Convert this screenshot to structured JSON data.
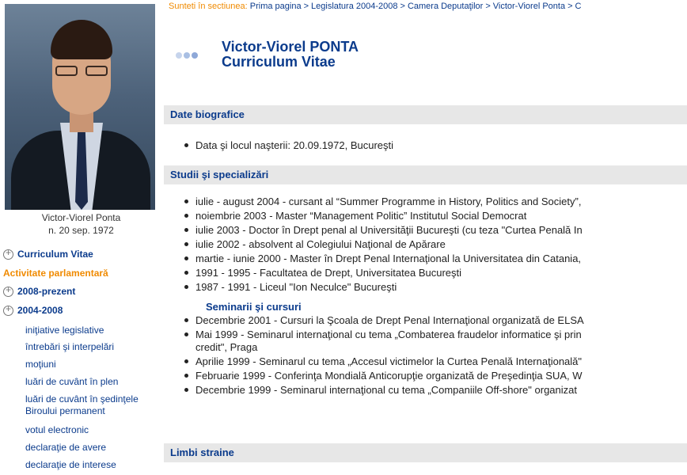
{
  "sidebar": {
    "caption_name": "Victor-Viorel Ponta",
    "caption_birth": "n. 20 sep. 1972",
    "nav_cv": "Curriculum Vitae",
    "nav_activitate": "Activitate parlamentară",
    "nav_2008": "2008-prezent",
    "nav_2004": "2004-2008",
    "sub_items": [
      "iniţiative legislative",
      "întrebări şi interpelări",
      "moţiuni",
      "luări de cuvânt în plen",
      "luări de cuvânt în şedinţele",
      "Biroului permanent",
      "votul electronic",
      "declaraţie de avere",
      "declaraţie de interese"
    ]
  },
  "breadcrumb": {
    "prefix": "Sunteti în sectiunea:",
    "items": [
      "Prima pagina",
      "Legislatura 2004-2008",
      "Camera Deputaţilor",
      "Victor-Viorel Ponta",
      "C"
    ]
  },
  "header": {
    "name": "Victor-Viorel PONTA",
    "subtitle": "Curriculum Vitae",
    "dot_colors": [
      "#c6d4ec",
      "#a9bfe3",
      "#8ea8d8"
    ]
  },
  "sections": {
    "bio_title": "Date biografice",
    "bio_items": [
      "Data şi locul naşterii: 20.09.1972, Bucureşti"
    ],
    "studies_title": "Studii şi specializări",
    "studies_items": [
      "iulie - august 2004 - cursant al “Summer Programme in History, Politics and Society”,",
      "noiembrie 2003 - Master “Management Politic” Institutul Social Democrat",
      "iulie 2003 - Doctor în Drept penal al Universităţii Bucureşti (cu teza \"Curtea Penală In",
      "iulie 2002 - absolvent al Colegiului Naţional de Apărare",
      "martie - iunie 2000 - Master în Drept Penal Internaţional la Universitatea din Catania,",
      "1991 - 1995 - Facultatea de Drept, Universitatea Bucureşti",
      "1987 - 1991 - Liceul \"Ion Neculce\" Bucureşti"
    ],
    "seminar_title": "Seminarii şi cursuri",
    "seminar_items": [
      "Decembrie 2001 - Cursuri la Şcoala de Drept Penal Internaţional organizată de ELSA",
      "Mai 1999 - Seminarul internaţional cu tema „Combaterea fraudelor informatice şi prin",
      "credit\", Praga",
      "Aprilie 1999 - Seminarul cu tema „Accesul victimelor la Curtea Penală Internaţională\"",
      "Februarie 1999 - Conferinţa Mondială Anticorupţie organizată de Preşedinţia SUA, W",
      "Decembrie 1999 - Seminarul internaţional cu tema „Companiile Off-shore\" organizat"
    ],
    "languages_title": "Limbi straine"
  }
}
